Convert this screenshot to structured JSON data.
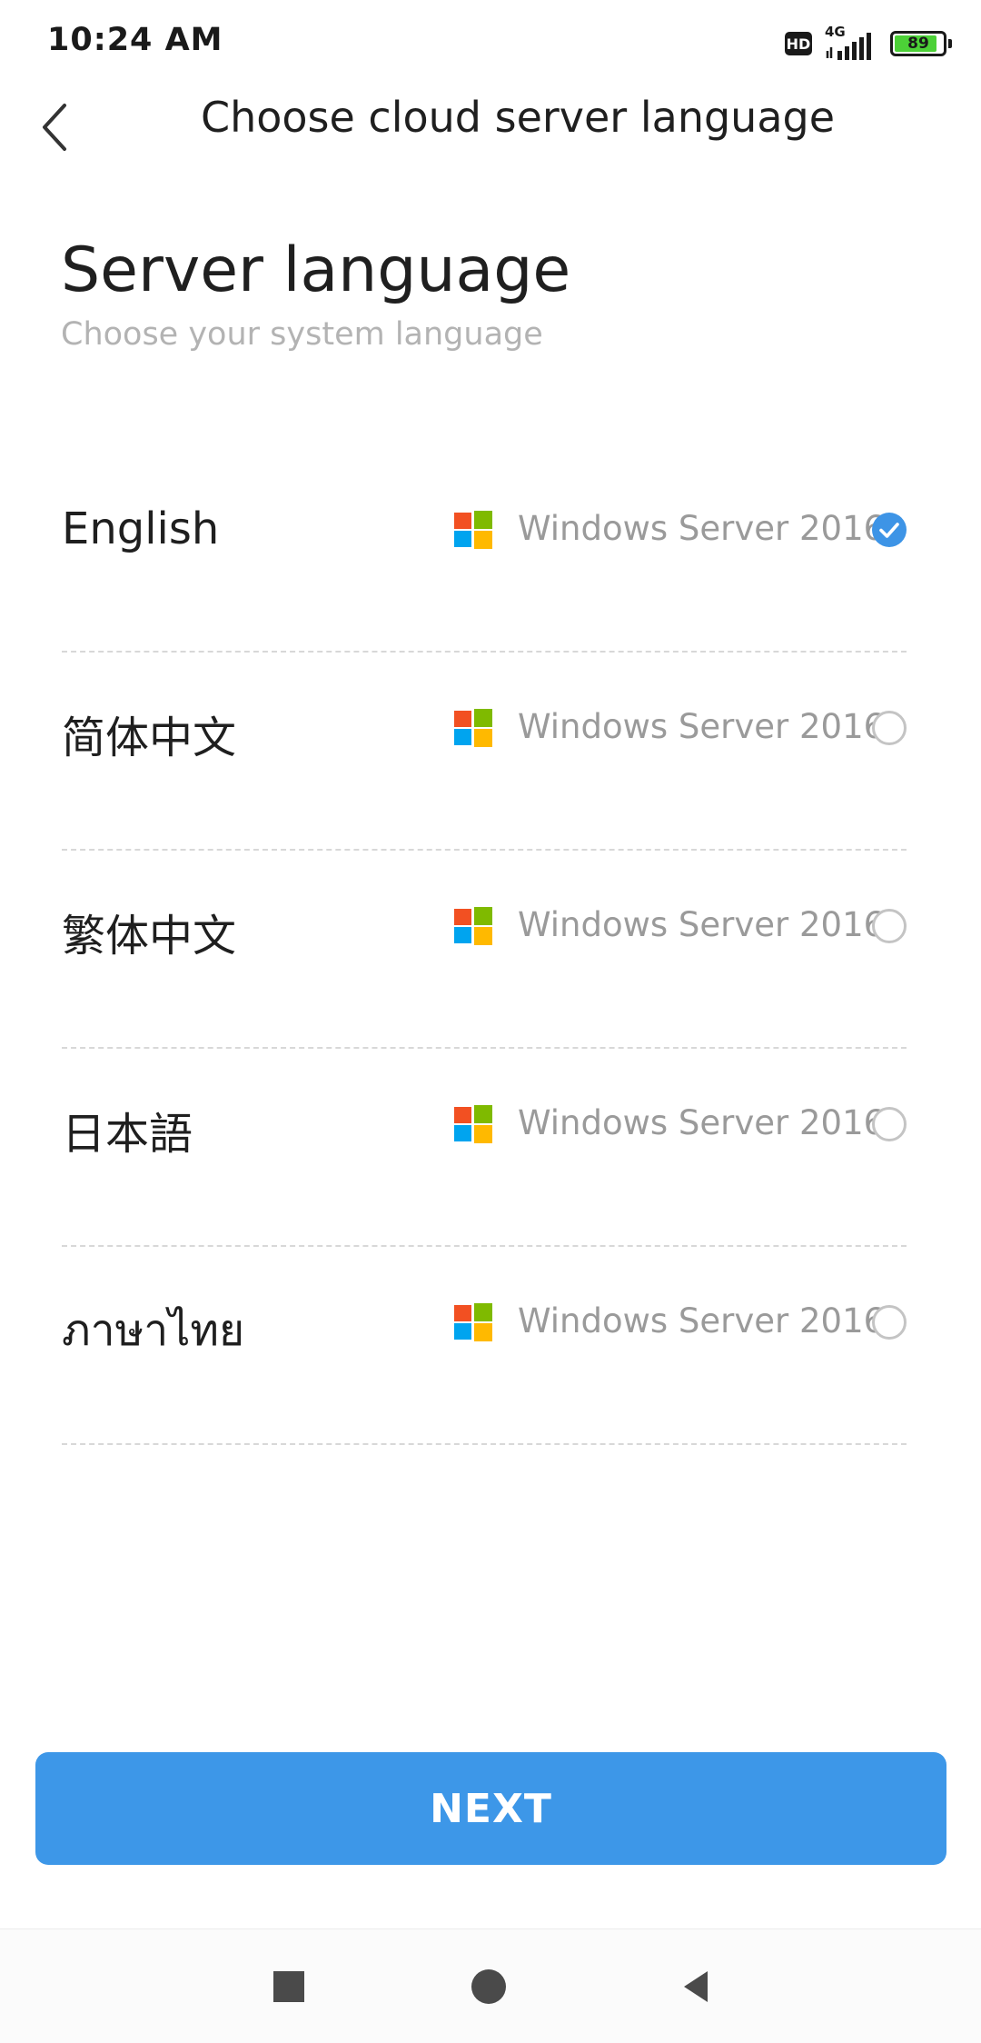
{
  "status_bar": {
    "time": "10:24 AM",
    "hd_label": "HD",
    "network_label": "4G",
    "battery_level": "89",
    "battery_fraction": 0.89
  },
  "header": {
    "title": "Choose cloud server language",
    "back_icon": "chevron-left-icon"
  },
  "section": {
    "title": "Server language",
    "subtitle": "Choose your system language"
  },
  "languages": [
    {
      "name": "English",
      "os": "Windows Server 2016",
      "selected": true
    },
    {
      "name": "简体中文",
      "os": "Windows Server 2016",
      "selected": false
    },
    {
      "name": "繁体中文",
      "os": "Windows Server 2016",
      "selected": false
    },
    {
      "name": "日本語",
      "os": "Windows Server 2016",
      "selected": false
    },
    {
      "name": "ภาษาไทย",
      "os": "Windows Server 2016",
      "selected": false
    }
  ],
  "next_button": {
    "label": "NEXT"
  },
  "nav_bar": {
    "recents_icon": "square-icon",
    "home_icon": "circle-icon",
    "back_icon": "triangle-back-icon"
  },
  "colors": {
    "accent": "#3d97e8",
    "windows_red": "#f25022",
    "windows_green": "#7fba00",
    "windows_blue": "#00a4ef",
    "windows_yellow": "#ffb900"
  }
}
